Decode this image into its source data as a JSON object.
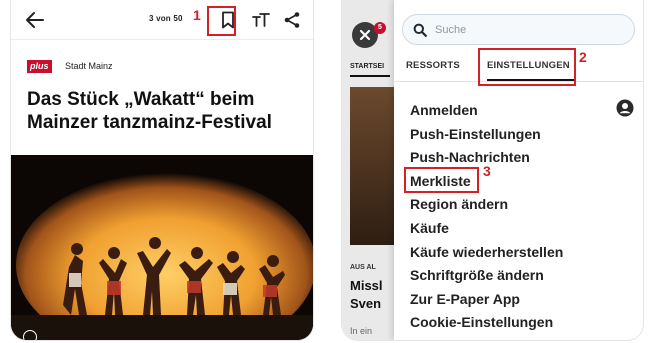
{
  "left_screen": {
    "page_count": "3 von 50",
    "badge": "plus",
    "section": "Stadt Mainz",
    "headline": "Das Stück „Wakatt“ beim Mainzer tanzmainz-Festival",
    "icons": [
      "back-arrow-icon",
      "bookmark-icon",
      "text-size-icon",
      "share-icon",
      "info-icon"
    ]
  },
  "right_screen": {
    "notification_count": "5",
    "search": {
      "placeholder": "Suche"
    },
    "tabs": [
      {
        "label": "RESSORTS",
        "active": false
      },
      {
        "label": "EINSTELLUNGEN",
        "active": true
      }
    ],
    "menu": [
      "Anmelden",
      "Push-Einstellungen",
      "Push-Nachrichten",
      "Merkliste",
      "Region ändern",
      "Käufe",
      "Käufe wiederherstellen",
      "Schriftgröße ändern",
      "Zur E-Paper App",
      "Cookie-Einstellungen"
    ],
    "background": {
      "tab": "STARTSEI",
      "kicker": "AUS AL",
      "title_line1": "Missl",
      "title_line2": "Sven",
      "teaser": "In ein"
    }
  },
  "annotations": [
    "1",
    "2",
    "3"
  ],
  "colors": {
    "annotation": "#d42027",
    "plus_badge": "#c8102e",
    "stage_light": "#f0a030"
  }
}
